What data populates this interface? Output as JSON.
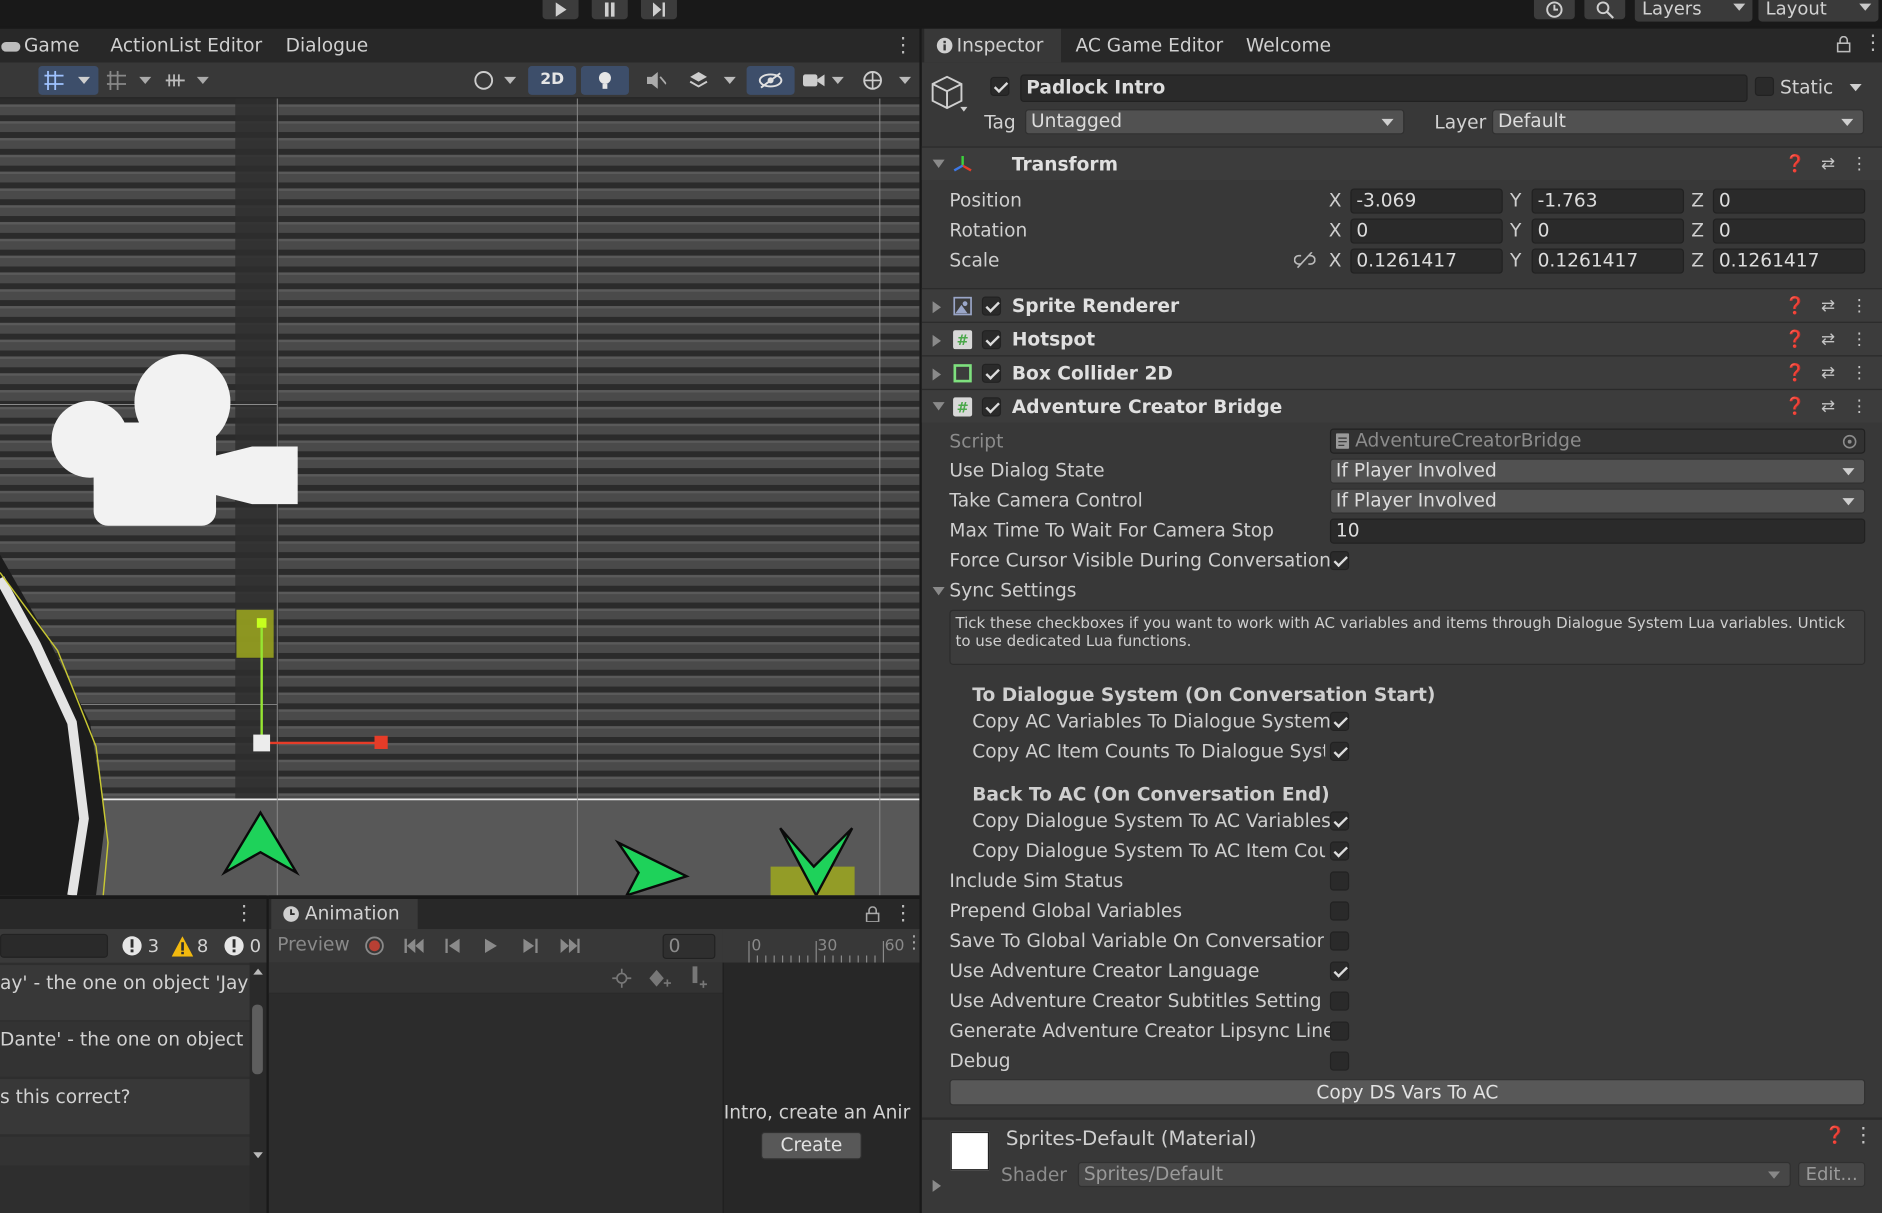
{
  "topbar": {
    "layers_label": "Layers",
    "layout_label": "Layout"
  },
  "left_tabs": {
    "game": "Game",
    "actionlist": "ActionList Editor",
    "dialogue": "Dialogue"
  },
  "scene_toolbar": {
    "mode_2d": "2D"
  },
  "console": {
    "counts": {
      "errors": "3",
      "warnings": "8",
      "messages": "0"
    },
    "lines": [
      "ay' - the one on object 'Jay'",
      "Dante' - the one on object 'Da",
      "s this correct?"
    ]
  },
  "animation": {
    "tab_label": "Animation",
    "preview_label": "Preview",
    "frame_value": "0",
    "ruler_ticks": [
      "0",
      "30",
      "60"
    ],
    "create_text": "Intro, create an Anir",
    "create_button": "Create"
  },
  "inspector": {
    "tabs": [
      "Inspector",
      "AC Game Editor",
      "Welcome"
    ],
    "object_name": "Padlock Intro",
    "static_label": "Static",
    "tag_label": "Tag",
    "tag_value": "Untagged",
    "layer_label": "Layer",
    "layer_value": "Default",
    "transform": {
      "title": "Transform",
      "position_label": "Position",
      "rotation_label": "Rotation",
      "scale_label": "Scale",
      "position": {
        "x": "-3.069",
        "y": "-1.763",
        "z": "0"
      },
      "rotation": {
        "x": "0",
        "y": "0",
        "z": "0"
      },
      "scale": {
        "x": "0.1261417",
        "y": "0.1261417",
        "z": "0.1261417"
      }
    },
    "components": {
      "sprite_renderer": "Sprite Renderer",
      "hotspot": "Hotspot",
      "box_collider": "Box Collider 2D",
      "ac_bridge": "Adventure Creator Bridge"
    },
    "bridge": {
      "script_label": "Script",
      "script_value": "AdventureCreatorBridge",
      "use_dialog_state_label": "Use Dialog State",
      "use_dialog_state_value": "If Player Involved",
      "take_camera_label": "Take Camera Control",
      "take_camera_value": "If Player Involved",
      "max_time_label": "Max Time To Wait For Camera Stop",
      "max_time_value": "10",
      "force_cursor_label": "Force Cursor Visible During Conversations",
      "sync_settings_label": "Sync Settings",
      "help_text": "Tick these checkboxes if you want to work with AC variables and items through Dialogue System Lua variables. Untick to use dedicated Lua functions.",
      "to_ds_heading": "To Dialogue System (On Conversation Start)",
      "copy_ac_vars": "Copy AC Variables To Dialogue System",
      "copy_ac_items": "Copy AC Item Counts To Dialogue Syste",
      "back_heading": "Back To AC (On Conversation End)",
      "copy_ds_vars": "Copy Dialogue System To AC Variables",
      "copy_ds_items": "Copy Dialogue System To AC Item Coun",
      "include_sim": "Include Sim Status",
      "prepend_global": "Prepend Global Variables",
      "save_global": "Save To Global Variable On Conversation I",
      "use_ac_language": "Use Adventure Creator Language",
      "use_ac_subtitles": "Use Adventure Creator Subtitles Setting",
      "gen_lipsync": "Generate Adventure Creator Lipsync Lines",
      "debug": "Debug",
      "copy_button": "Copy DS Vars To AC"
    },
    "material": {
      "name": "Sprites-Default (Material)",
      "shader_label": "Shader",
      "shader_value": "Sprites/Default",
      "edit_button": "Edit..."
    }
  }
}
